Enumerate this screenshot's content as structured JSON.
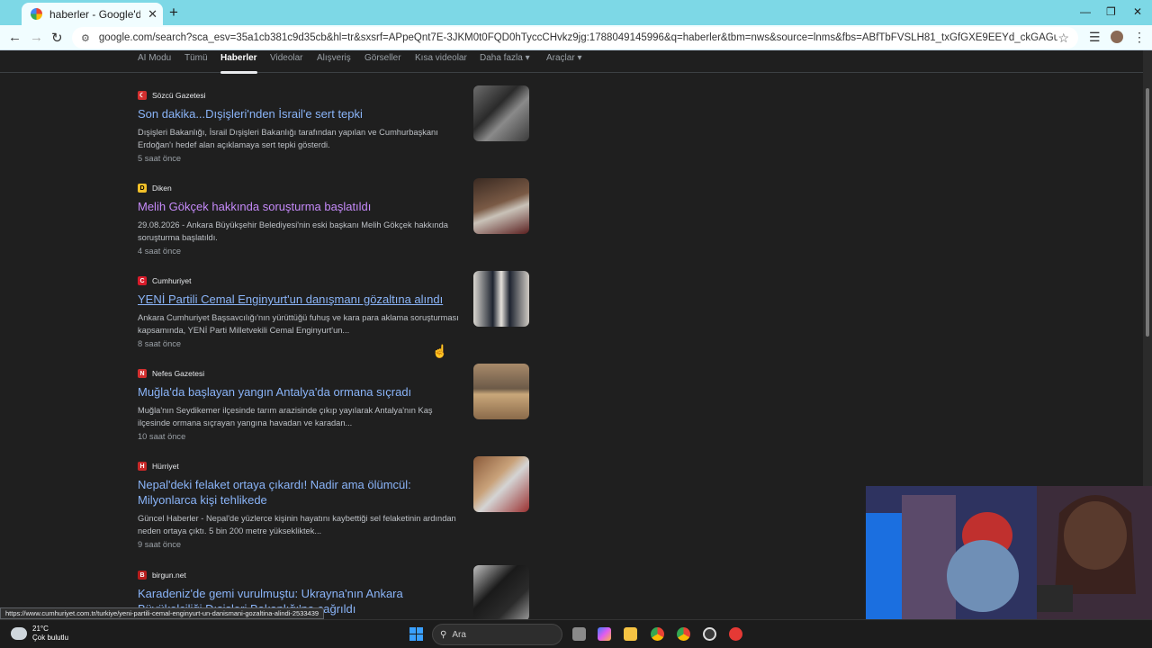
{
  "browser": {
    "tab_title": "haberler - Google'da Ara",
    "url": "google.com/search?sca_esv=35a1cb381c9d35cb&hl=tr&sxsrf=APpeQnt7E-3JKM0t0FQD0hTyccCHvkz9jg:1788049145996&q=haberler&tbm=nws&source=lnms&fbs=ABfTbFVSLH81_txGfGXE9EEYd_ckGAGulfltWt-EPYqUuAQYg345snCbVGbmCZMbFzFAYMiEh..."
  },
  "search_tabs": [
    {
      "label": "AI Modu"
    },
    {
      "label": "Tümü"
    },
    {
      "label": "Haberler"
    },
    {
      "label": "Videolar"
    },
    {
      "label": "Alışveriş"
    },
    {
      "label": "Görseller"
    },
    {
      "label": "Kısa videolar"
    },
    {
      "label": "Daha fazla",
      "caret": "▾"
    },
    {
      "label": "Araçlar",
      "caret": "▾"
    }
  ],
  "results": [
    {
      "source": "Sözcü Gazetesi",
      "icon_letter": "☾",
      "icon_color": "#d32f2f",
      "title": "Son dakika...Dışişleri'nden İsrail'e sert tepki",
      "snippet": "Dışişleri Bakanlığı, İsrail Dışişleri Bakanlığı tarafından yapılan ve Cumhurbaşkanı Erdoğan'ı hedef alan açıklamaya sert tepki gösterdi.",
      "time": "5 saat önce"
    },
    {
      "source": "Diken",
      "icon_letter": "D",
      "icon_color": "#f2c029",
      "title": "Melih Gökçek hakkında soruşturma başlatıldı",
      "snippet": "29.08.2026 - Ankara Büyükşehir Belediyesi'nin eski başkanı Melih Gökçek hakkında soruşturma başlatıldı.",
      "time": "4 saat önce"
    },
    {
      "source": "Cumhuriyet",
      "icon_letter": "C",
      "icon_color": "#d81b2a",
      "title": "YENİ Partili Cemal Enginyurt'un danışmanı gözaltına alındı",
      "snippet": "Ankara Cumhuriyet Başsavcılığı'nın yürüttüğü fuhuş ve kara para aklama soruşturması kapsamında, YENİ Parti Milletvekili Cemal Enginyurt'un...",
      "time": "8 saat önce"
    },
    {
      "source": "Nefes Gazetesi",
      "icon_letter": "N",
      "icon_color": "#d32f2f",
      "title": "Muğla'da başlayan yangın Antalya'da ormana sıçradı",
      "snippet": "Muğla'nın Seydikemer ilçesinde tarım arazisinde çıkıp yayılarak Antalya'nın Kaş ilçesinde ormana sıçrayan yangına havadan ve karadan...",
      "time": "10 saat önce"
    },
    {
      "source": "Hürriyet",
      "icon_letter": "H",
      "icon_color": "#c62828",
      "title": "Nepal'deki felaket ortaya çıkardı! Nadir ama ölümcül: Milyonlarca kişi tehlikede",
      "snippet": "Güncel Haberler - Nepal'de yüzlerce kişinin hayatını kaybettiği sel felaketinin ardından neden ortaya çıktı. 5 bin 200 metre yüksekliktek...",
      "time": "9 saat önce"
    },
    {
      "source": "birgun.net",
      "icon_letter": "B",
      "icon_color": "#b71c1c",
      "title": "Karadeniz'de gemi vurulmuştu: Ukrayna'nın Ankara Büyükelçiliği Dışişleri Bakanlığı'na çağrıldı",
      "snippet": "",
      "time": ""
    }
  ],
  "status_url": "https://www.cumhuriyet.com.tr/turkiye/yeni-partili-cemal-enginyurt-un-danismani-gozaltina-alindi-2533439",
  "taskbar": {
    "temperature": "21°C",
    "weather": "Çok bulutlu",
    "search_placeholder": "Ara"
  }
}
